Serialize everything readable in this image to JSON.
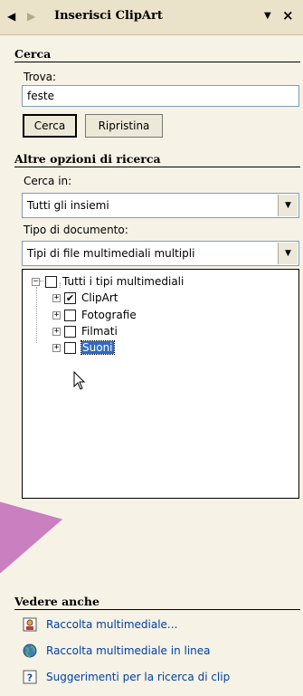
{
  "header": {
    "back_icon": "back-arrow-icon",
    "forward_icon": "forward-arrow-icon",
    "title": "Inserisci ClipArt",
    "dropdown_icon": "chevron-down-icon",
    "close_label": "×"
  },
  "search": {
    "section_title": "Cerca",
    "find_label": "Trova:",
    "query": "feste",
    "search_button": "Cerca",
    "reset_button": "Ripristina"
  },
  "options": {
    "section_title": "Altre opzioni di ricerca",
    "search_in_label": "Cerca in:",
    "search_in_value": "Tutti gli insiemi",
    "doc_type_label": "Tipo di documento:",
    "doc_type_value": "Tipi di file multimediali multipli",
    "tree": {
      "root": {
        "label": "Tutti i tipi multimediali",
        "checked": false
      },
      "children": [
        {
          "label": "ClipArt",
          "checked": true
        },
        {
          "label": "Fotografie",
          "checked": false
        },
        {
          "label": "Filmati",
          "checked": false
        },
        {
          "label": "Suoni",
          "checked": false,
          "selected": true
        }
      ]
    }
  },
  "see_also": {
    "section_title": "Vedere anche",
    "links": [
      {
        "label": "Raccolta multimediale...",
        "icon": "media-gallery-icon"
      },
      {
        "label": "Raccolta multimediale in linea",
        "icon": "globe-icon"
      },
      {
        "label": "Suggerimenti per la ricerca di clip",
        "icon": "help-icon"
      }
    ]
  },
  "colors": {
    "pane_bg": "#f6f2e6",
    "header_bg": "#ebe3c9",
    "link": "#0040a0",
    "selection": "#316ac5",
    "overlay_arrow": "#c97fc0"
  }
}
